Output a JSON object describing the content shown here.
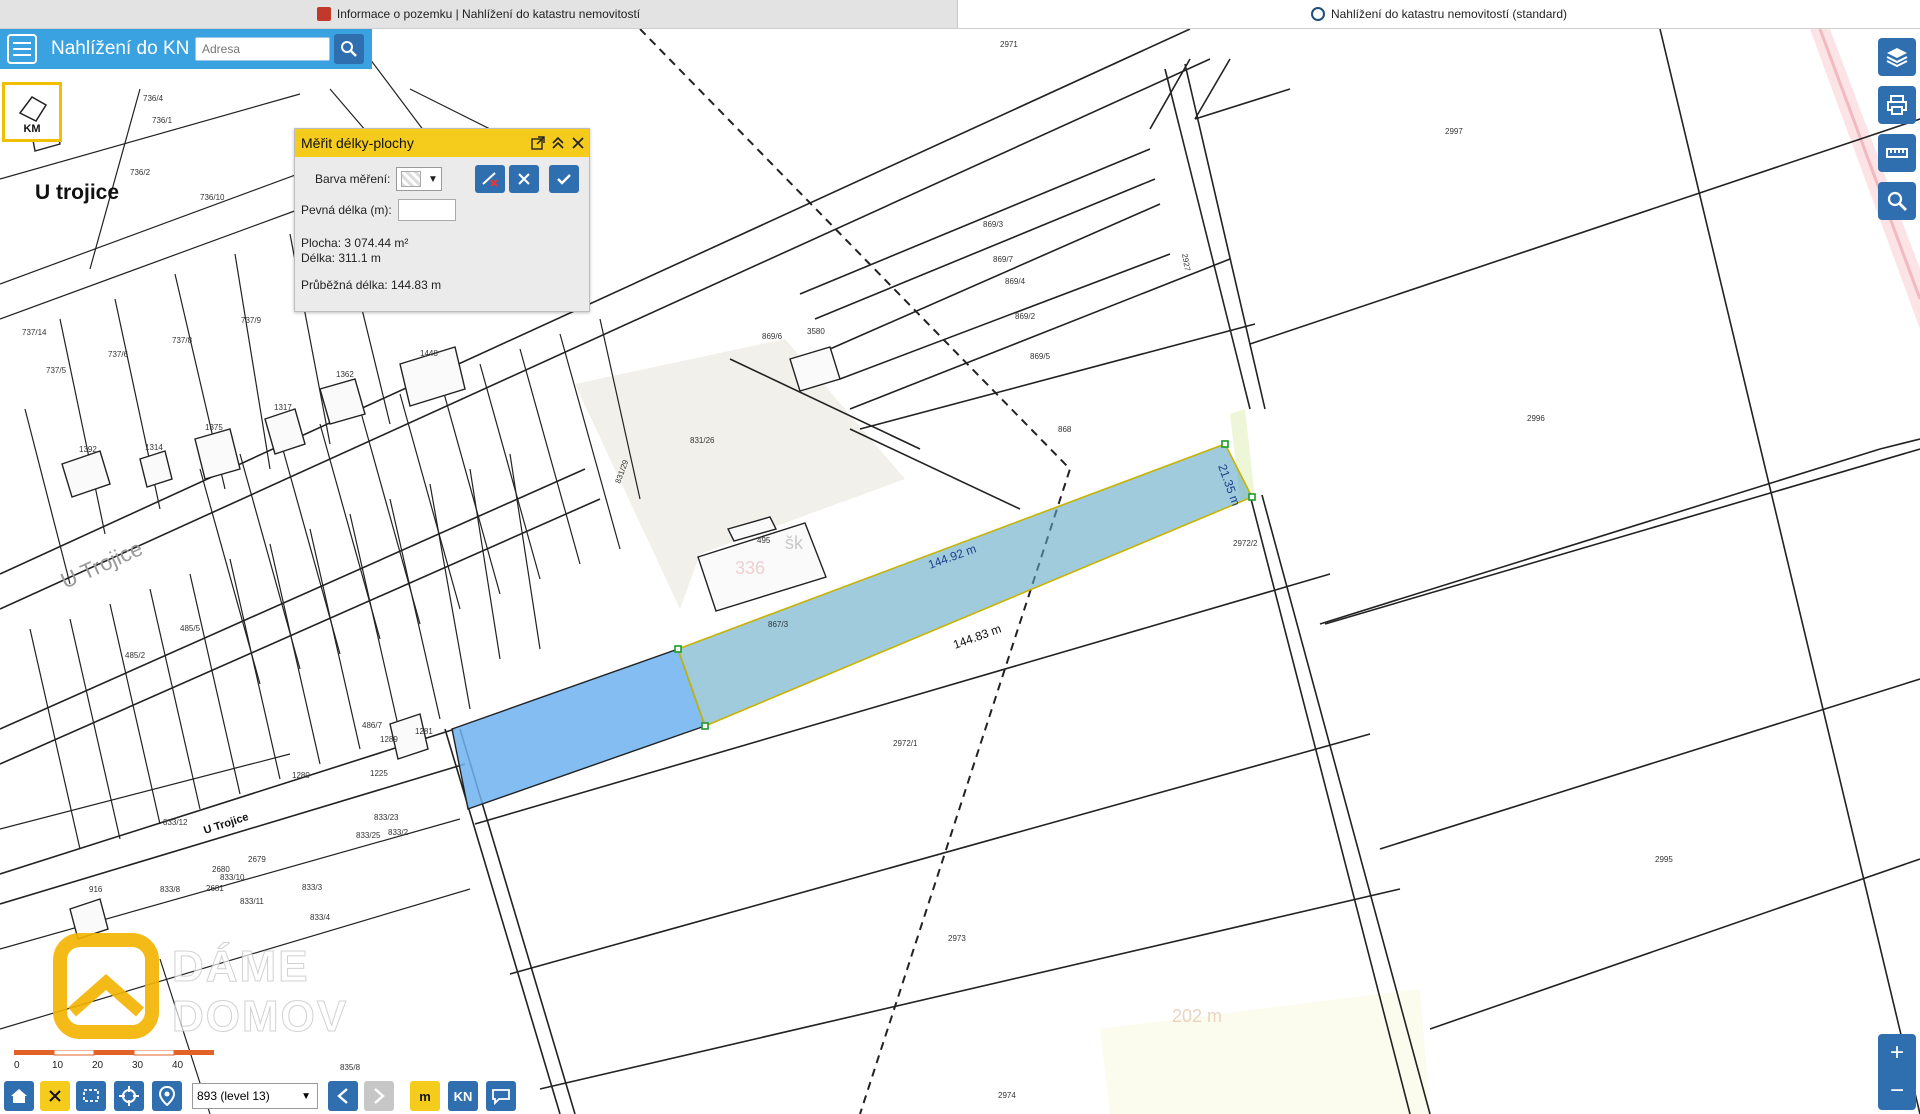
{
  "tabs": [
    {
      "label": "Informace o pozemku | Nahlížení do katastru nemovitostí",
      "icon": "cz-emblem-icon"
    },
    {
      "label": "Nahlížení do katastru nemovitostí (standard)",
      "icon": "globe-icon"
    }
  ],
  "topbar": {
    "title": "Nahlížení do KN",
    "search_placeholder": "Adresa"
  },
  "km_button": {
    "label": "KM"
  },
  "measure_panel": {
    "title": "Měřit délky-plochy",
    "color_label": "Barva měření:",
    "fixed_length_label": "Pevná délka (m):",
    "area": "Plocha: 3 074.44 m²",
    "length": "Délka: 311.1 m",
    "running_length": "Průběžná délka: 144.83 m"
  },
  "map": {
    "street_labels": [
      "U trojice",
      "U Trojice",
      "U Trojice"
    ],
    "parcel_labels": [
      "2971",
      "2997",
      "2996",
      "2995",
      "2973",
      "2974",
      "2972/1",
      "2972/2",
      "2927",
      "869/3",
      "869/7",
      "869/4",
      "869/2",
      "869/5",
      "869/6",
      "868",
      "3580",
      "831/26",
      "495",
      "867/3",
      "831/29",
      "1448",
      "1362",
      "1317",
      "1375",
      "1314",
      "1392",
      "737/14",
      "737/5",
      "737/6",
      "737/8",
      "737/9",
      "736/4",
      "736/1",
      "736/2",
      "736/10",
      "485/5",
      "485/2",
      "486/7",
      "1289",
      "1281",
      "1280",
      "1225",
      "833/12",
      "833/23",
      "833/25",
      "833/2",
      "833/3",
      "833/4",
      "833/8",
      "833/10",
      "833/11",
      "916",
      "835/8",
      "2681",
      "2680",
      "2679"
    ],
    "measurements": [
      "144.92 m",
      "144.83 m",
      "21.35 m"
    ],
    "faded_labels": [
      "202 m",
      "šk",
      "336"
    ]
  },
  "bottom_bar": {
    "level_select": "893 (level 13)",
    "btn_m": "m",
    "btn_kn": "KN"
  },
  "scale": {
    "ticks": [
      "0",
      "10",
      "20",
      "30",
      "40"
    ]
  },
  "watermark": {
    "line1": "DÁME",
    "line2": "DOMOV"
  },
  "colors": {
    "accent_blue": "#3aa2e0",
    "button_blue": "#2f6fb0",
    "panel_yellow": "#f5cc1c",
    "measure_fill": "#5fa8c7",
    "selected_parcel": "#6fb1ef"
  }
}
